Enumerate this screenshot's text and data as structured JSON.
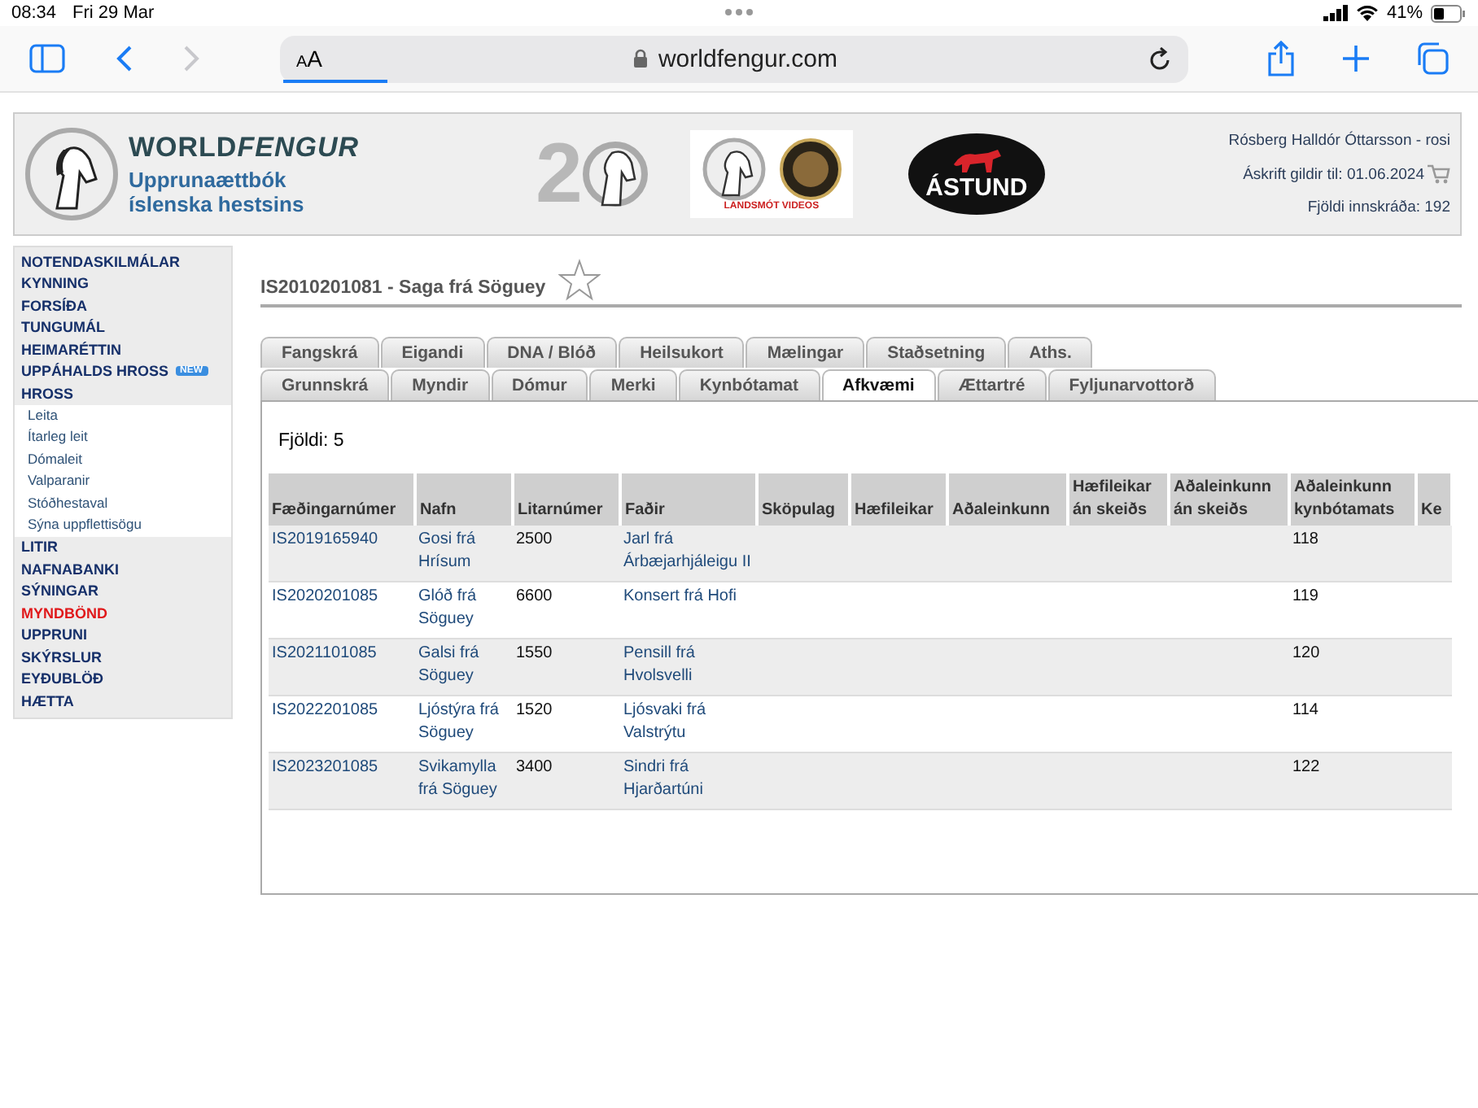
{
  "status_bar": {
    "time": "08:34",
    "date": "Fri 29 Mar",
    "battery": "41%"
  },
  "browser": {
    "reader_label": "AA",
    "url": "worldfengur.com"
  },
  "header": {
    "brand_plain": "WORLD",
    "brand_italic": "FENGUR",
    "subtitle_lines": [
      "Upprunaættbók",
      "íslenska hestsins"
    ],
    "anniversary_text": "2",
    "videos_label": "LANDSMÓT VIDEOS",
    "sponsor_label": "ÁSTUND",
    "user": "Rósberg Halldór Óttarsson - rosi",
    "subscription": "Áskrift gildir til: 01.06.2024",
    "entries": "Fjöldi innskráða: 192"
  },
  "sidebar": {
    "items": [
      {
        "label": "NOTENDASKILMÁLAR",
        "highlighted": false
      },
      {
        "label": "KYNNING",
        "highlighted": false
      },
      {
        "label": "FORSÍÐA",
        "highlighted": false
      },
      {
        "label": "TUNGUMÁL",
        "highlighted": false
      },
      {
        "label": "HEIMARÉTTIN",
        "highlighted": false
      },
      {
        "label": "UPPÁHALDS HROSS",
        "highlighted": false,
        "badge": "NEW"
      },
      {
        "label": "HROSS",
        "highlighted": false,
        "children": [
          {
            "label": "Leita"
          },
          {
            "label": "Ítarleg leit"
          },
          {
            "label": "Dómaleit"
          },
          {
            "label": "Valparanir"
          },
          {
            "label": "Stóðhestaval"
          },
          {
            "label": "Sýna uppflettisögu"
          }
        ]
      },
      {
        "label": "LITIR",
        "highlighted": false
      },
      {
        "label": "NAFNABANKI",
        "highlighted": false
      },
      {
        "label": "SÝNINGAR",
        "highlighted": false
      },
      {
        "label": "MYNDBÖND",
        "highlighted": true
      },
      {
        "label": "UPPRUNI",
        "highlighted": false
      },
      {
        "label": "SKÝRSLUR",
        "highlighted": false
      },
      {
        "label": "EYÐUBLÖÐ",
        "highlighted": false
      },
      {
        "label": "HÆTTA",
        "highlighted": false
      }
    ]
  },
  "horse_title": "IS2010201081 - Saga frá Söguey",
  "favorite": false,
  "tab_rows": [
    [
      {
        "label": "Fangskrá",
        "selected": false
      },
      {
        "label": "Eigandi",
        "selected": false
      },
      {
        "label": "DNA / Blóð",
        "selected": false
      },
      {
        "label": "Heilsukort",
        "selected": false
      },
      {
        "label": "Mælingar",
        "selected": false
      },
      {
        "label": "Staðsetning",
        "selected": false
      },
      {
        "label": "Aths.",
        "selected": false
      }
    ],
    [
      {
        "label": "Grunnskrá",
        "selected": false
      },
      {
        "label": "Myndir",
        "selected": false
      },
      {
        "label": "Dómur",
        "selected": false
      },
      {
        "label": "Merki",
        "selected": false
      },
      {
        "label": "Kynbótamat",
        "selected": false
      },
      {
        "label": "Afkvæmi",
        "selected": true
      },
      {
        "label": "Ættartré",
        "selected": false
      },
      {
        "label": "Fyljunarvottorð",
        "selected": false
      }
    ]
  ],
  "count": "Fjöldi: 5",
  "table": {
    "columns": [
      "Fæðingarnúmer",
      "Nafn",
      "Litarnúmer",
      "Faðir",
      "Sköpulag",
      "Hæfileikar",
      "Aðaleinkunn",
      "Hæfileikar án skeiðs",
      "Aðaleinkunn án skeiðs",
      "Aðaleinkunn kynbótamats",
      "Ke"
    ],
    "rows": [
      [
        "IS2019165940",
        "Gosi frá Hrísum",
        "2500",
        "Jarl frá Árbæjarhjáleigu II",
        "",
        "",
        "",
        "",
        "",
        "118"
      ],
      [
        "IS2020201085",
        "Glóð frá Söguey",
        "6600",
        "Konsert frá Hofi",
        "",
        "",
        "",
        "",
        "",
        "119"
      ],
      [
        "IS2021101085",
        "Galsi frá Söguey",
        "1550",
        "Pensill frá Hvolsvelli",
        "",
        "",
        "",
        "",
        "",
        "120"
      ],
      [
        "IS2022201085",
        "Ljóstýra frá Söguey",
        "1520",
        "Ljósvaki frá Valstrýtu",
        "",
        "",
        "",
        "",
        "",
        "114"
      ],
      [
        "IS2023201085",
        "Svikamylla frá Söguey",
        "3400",
        "Sindri frá Hjarðartúni",
        "",
        "",
        "",
        "",
        "",
        "122"
      ]
    ]
  }
}
